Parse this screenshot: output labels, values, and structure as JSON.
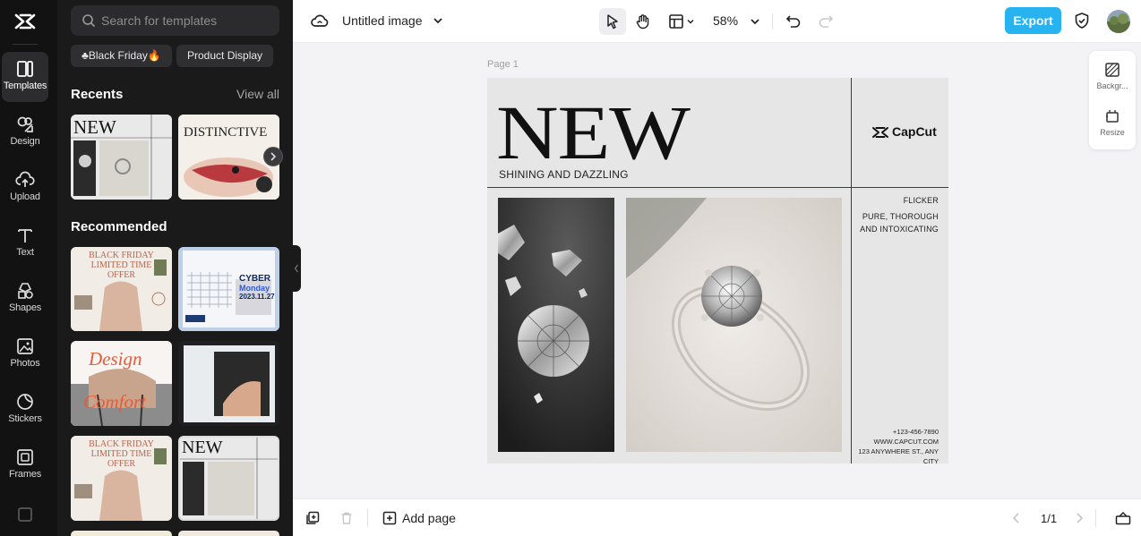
{
  "rail": {
    "items": [
      {
        "label": "Templates",
        "icon": "templates-icon"
      },
      {
        "label": "Design",
        "icon": "design-icon"
      },
      {
        "label": "Upload",
        "icon": "upload-icon"
      },
      {
        "label": "Text",
        "icon": "text-icon"
      },
      {
        "label": "Shapes",
        "icon": "shapes-icon"
      },
      {
        "label": "Photos",
        "icon": "photos-icon"
      },
      {
        "label": "Stickers",
        "icon": "stickers-icon"
      },
      {
        "label": "Frames",
        "icon": "frames-icon"
      }
    ]
  },
  "panel": {
    "search_placeholder": "Search for templates",
    "chips": [
      "♣Black Friday🔥",
      "Product Display"
    ],
    "recents_title": "Recents",
    "view_all": "View all",
    "recommended_title": "Recommended",
    "thumb_texts": {
      "new": "NEW",
      "distinctive": "DISTINCTIVE",
      "bf_line1": "BLACK FRIDAY",
      "bf_line2": "LIMITED TIME",
      "bf_line3": "OFFER",
      "cyber": "CYBER",
      "monday": "Monday",
      "cyber_date": "2023.11.27",
      "design": "Design",
      "comfort": "Comfort"
    }
  },
  "topbar": {
    "doc_title": "Untitled image",
    "zoom": "58%",
    "export_label": "Export"
  },
  "canvas": {
    "page_label": "Page 1",
    "headline": "NEW",
    "subheadline": "SHINING AND DAZZLING",
    "brand": "CapCut",
    "right_1": "FLICKER",
    "right_2": "PURE, THOROUGH",
    "right_3": "AND INTOXICATING",
    "phone": "+123-456-7890",
    "web": "WWW.CAPCUT.COM",
    "address": "123 ANYWHERE ST., ANY CITY"
  },
  "side_tools": {
    "background": "Backgr...",
    "resize": "Resize"
  },
  "bottombar": {
    "add_page": "Add page",
    "page_count": "1/1"
  },
  "colors": {
    "accent": "#26b3f0",
    "rail_bg": "#121212",
    "panel_bg": "#1a1a1a",
    "canvas_bg": "#f3f3f5"
  }
}
